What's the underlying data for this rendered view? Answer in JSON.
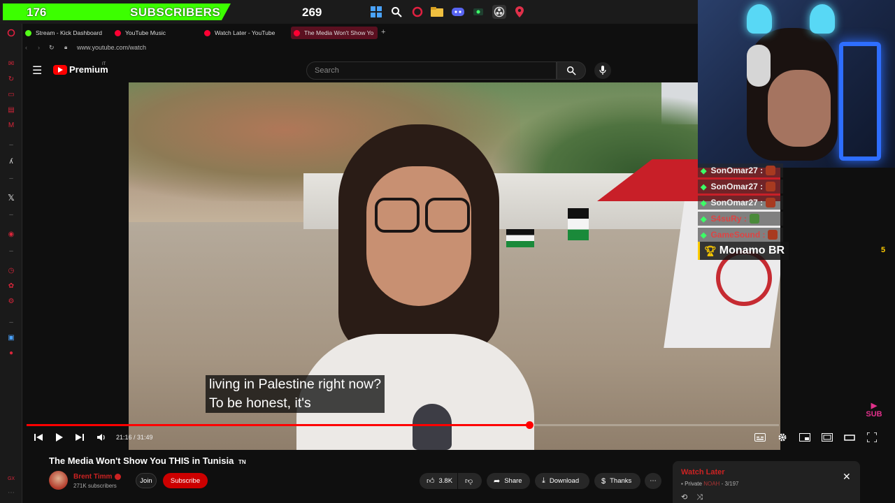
{
  "overlay": {
    "subscriber_count": "176",
    "subscriber_label": "SUBSCRIBERS",
    "secondary_count": "269",
    "accent_color": "#3cff00"
  },
  "browser": {
    "tabs": [
      {
        "label": "Stream - Kick Dashboard",
        "favicon_color": "#53fc18"
      },
      {
        "label": "YouTube Music",
        "favicon_color": "#ff0033"
      },
      {
        "label": "Watch Later - YouTube",
        "favicon_color": "#ff0033"
      },
      {
        "label": "The Media Won't Show Yo",
        "favicon_color": "#ff0033"
      }
    ],
    "new_tab_icon": "plus-icon",
    "url": "www.youtube.com/watch"
  },
  "youtube": {
    "logo_text": "Premium",
    "country_code": "IT",
    "search_placeholder": "Search"
  },
  "player": {
    "caption_line1": "living in Palestine right now?",
    "caption_line2": "To be honest, it's",
    "time_display": "21:16 / 31:49",
    "progress_fraction": 0.6686
  },
  "chat": {
    "rows": [
      {
        "user": "SonOmar27 :"
      },
      {
        "user": "SonOmar27 :"
      },
      {
        "user": "SonOmar27 :"
      },
      {
        "user": "S4suRy :"
      },
      {
        "user": "GameSound :"
      }
    ],
    "donor_name": "Monamo BR",
    "donor_count": "5",
    "sub_watermark": "SUB"
  },
  "video_info": {
    "title": "The Media Won't Show You THIS in Tunisia",
    "title_suffix": "TN",
    "channel_name": "Brent Timm",
    "subscribers": "271K subscribers",
    "join_label": "Join",
    "subscribe_label": "Subscribe",
    "likes": "3.8K",
    "share_label": "Share",
    "download_label": "Download",
    "thanks_label": "Thanks"
  },
  "watch_later": {
    "title": "Watch Later",
    "privacy": "Private",
    "owner": "NOAH",
    "position": "- 3/197"
  }
}
